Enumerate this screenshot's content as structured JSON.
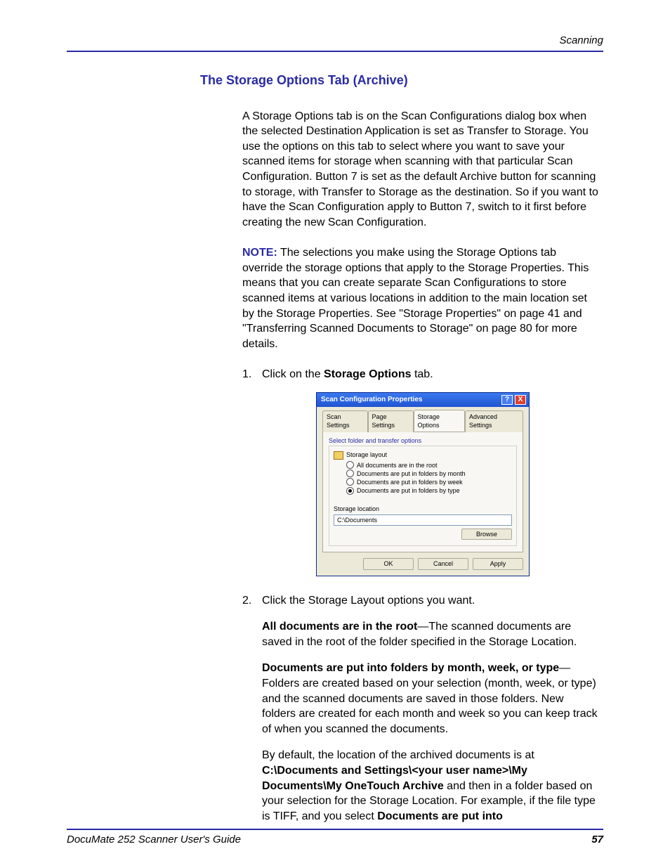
{
  "header_right": "Scanning",
  "section_title": "The Storage Options Tab (Archive)",
  "para1": "A Storage Options tab is on the Scan Configurations dialog box when the selected Destination Application is set as Transfer to Storage. You use the options on this tab to select where you want to save your scanned items for storage when scanning with that particular Scan Configuration. Button 7 is set as the default Archive button for scanning to storage, with Transfer to Storage as the destination. So if you want to have the Scan Configuration apply to Button 7, switch to it first before creating the new Scan Configuration.",
  "note_label": "NOTE:",
  "para2": "  The selections you make using the Storage Options tab override the storage options that apply to the Storage Properties. This means that you can create separate Scan Configurations to store scanned items at various locations in addition to the main location set by the Storage Properties. See \"Storage Properties\" on page 41 and \"Transferring Scanned Documents to Storage\" on page 80 for more details.",
  "step1_num": "1.",
  "step1_a": "Click on the ",
  "step1_b": "Storage Options",
  "step1_c": " tab.",
  "step2_num": "2.",
  "step2_text": "Click the Storage Layout options you want.",
  "opt1_b": "All documents are in the root",
  "opt1_t": "—The scanned documents are saved in the root of the folder specified in the Storage Location.",
  "opt2_b": "Documents are put into folders by month, week, or type",
  "opt2_t": "—Folders are created based on your selection (month, week, or type) and the scanned documents are saved in those folders. New folders are created for each month and week so you can keep track of when you scanned the documents.",
  "para3_a": "By default, the location of the archived documents is at ",
  "para3_b": "C:\\Documents and Settings\\<your user name>\\My Documents\\My OneTouch Archive",
  "para3_c": " and then in a folder based on your selection for the Storage Location. For example, if the file type is TIFF, and you select ",
  "para3_d": "Documents are put into ",
  "dialog": {
    "title": "Scan Configuration Properties",
    "tabs": {
      "t1": "Scan Settings",
      "t2": "Page Settings",
      "t3": "Storage Options",
      "t4": "Advanced Settings"
    },
    "fieldset_label": "Select folder and transfer options",
    "storage_layout": "Storage layout",
    "radios": {
      "r1": "All documents are in the root",
      "r2": "Documents are put in folders by month",
      "r3": "Documents are put in folders by week",
      "r4": "Documents are put in folders by type"
    },
    "storage_location_label": "Storage location",
    "storage_location_value": "C:\\Documents",
    "browse": "Browse",
    "ok": "OK",
    "cancel": "Cancel",
    "apply": "Apply"
  },
  "footer_left": "DocuMate 252 Scanner User's Guide",
  "footer_right": "57"
}
